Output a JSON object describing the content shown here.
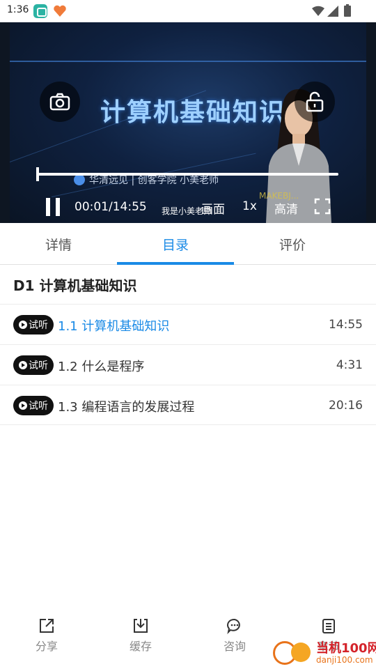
{
  "status_bar": {
    "time": "1:36"
  },
  "player": {
    "video_title": "计算机基础知识",
    "credit": "华清远见 | 创客学院 小美老师",
    "watermark": "MAKEBJ...",
    "time": "00:01/14:55",
    "subtitle": "我是小美老师",
    "picture_label": "画面",
    "speed_label": "1x",
    "quality_label": "高清",
    "progress": 0.001
  },
  "tabs": [
    {
      "label": "详情"
    },
    {
      "label": "目录"
    },
    {
      "label": "评价"
    }
  ],
  "active_tab": "目录",
  "chapter": {
    "title": "D1  计算机基础知识"
  },
  "lessons": [
    {
      "badge": "试听",
      "title": "1.1 计算机基础知识",
      "duration": "14:55",
      "active": true
    },
    {
      "badge": "试听",
      "title": "1.2 什么是程序",
      "duration": "4:31",
      "active": false
    },
    {
      "badge": "试听",
      "title": "1.3 编程语言的发展过程",
      "duration": "20:16",
      "active": false
    }
  ],
  "bottom_nav": {
    "share": "分享",
    "cache": "缓存",
    "consult": "咨询",
    "chapter": "章节"
  },
  "site_logo": {
    "name": "当机100网",
    "url": "danji100.com"
  },
  "colors": {
    "accent": "#1a8ae6",
    "badge": "#111111"
  }
}
